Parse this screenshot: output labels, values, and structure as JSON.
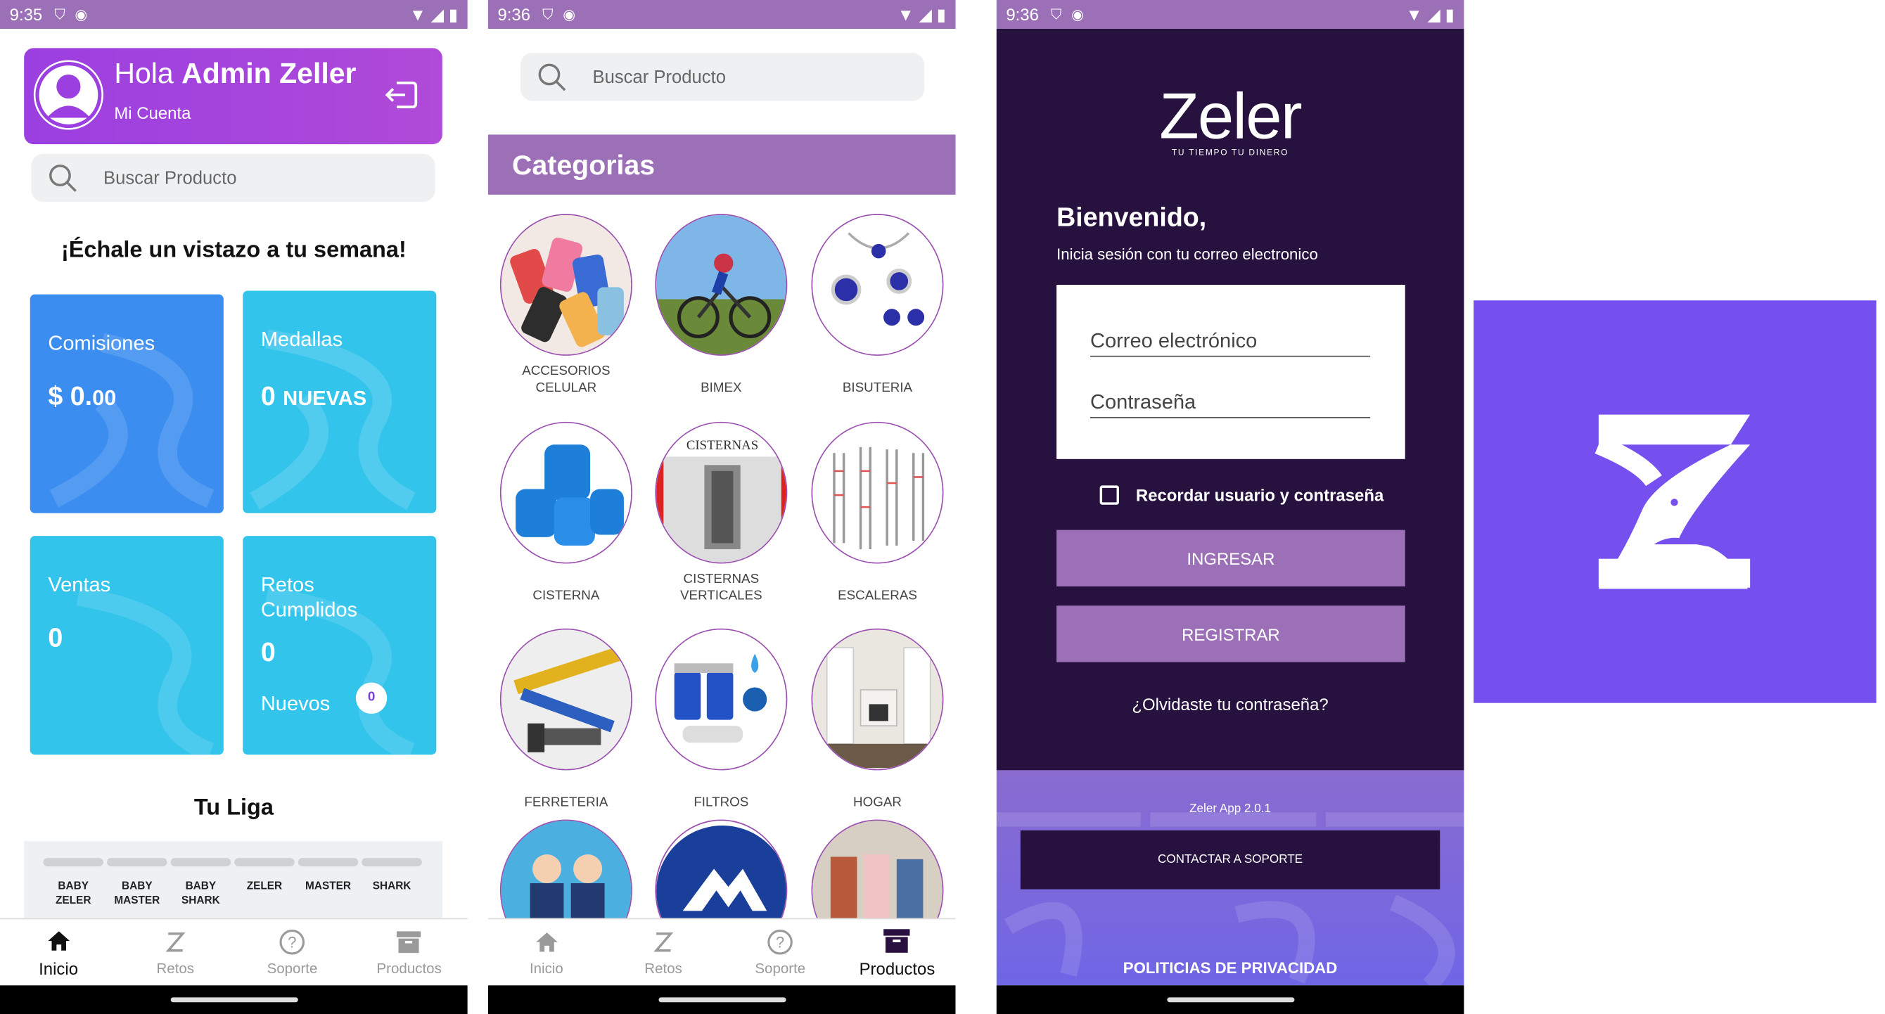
{
  "status": {
    "time1": "9:35",
    "time2": "9:36",
    "time3": "9:36"
  },
  "home": {
    "greeting_prefix": "Hola",
    "greeting_name": "Admin Zeller",
    "my_account": "Mi Cuenta",
    "search_placeholder": "Buscar Producto",
    "week_title": "¡Échale un vistazo a tu semana!",
    "cards": {
      "comisiones": {
        "label": "Comisiones",
        "value_main": "$ 0.",
        "value_cents": "00",
        "color": "#3b8ef0"
      },
      "medallas": {
        "label": "Medallas",
        "value_num": "0",
        "value_text": "NUEVAS",
        "color": "#33c4ec"
      },
      "ventas": {
        "label": "Ventas",
        "value": "0",
        "color": "#33c4ec"
      },
      "retos": {
        "label_line1": "Retos",
        "label_line2": "Cumplidos",
        "value": "0",
        "new_label": "Nuevos",
        "new_count": "0",
        "color": "#33c4ec"
      }
    },
    "league_title": "Tu Liga",
    "leagues": [
      {
        "line1": "BABY",
        "line2": "ZELER"
      },
      {
        "line1": "BABY",
        "line2": "MASTER"
      },
      {
        "line1": "BABY",
        "line2": "SHARK"
      },
      {
        "line1": "ZELER",
        "line2": ""
      },
      {
        "line1": "MASTER",
        "line2": ""
      },
      {
        "line1": "SHARK",
        "line2": ""
      }
    ]
  },
  "nav": {
    "inicio": "Inicio",
    "retos": "Retos",
    "soporte": "Soporte",
    "productos": "Productos"
  },
  "products": {
    "search_placeholder": "Buscar Producto",
    "header": "Categorias",
    "categories": [
      {
        "line1": "ACCESORIOS",
        "line2": "CELULAR"
      },
      {
        "line1": "BIMEX",
        "line2": ""
      },
      {
        "line1": "BISUTERIA",
        "line2": ""
      },
      {
        "line1": "CISTERNA",
        "line2": ""
      },
      {
        "line1": "CISTERNAS",
        "line2": "VERTICALES"
      },
      {
        "line1": "ESCALERAS",
        "line2": ""
      },
      {
        "line1": "FERRETERIA",
        "line2": ""
      },
      {
        "line1": "FILTROS",
        "line2": ""
      },
      {
        "line1": "HOGAR",
        "line2": ""
      }
    ],
    "cisternas_image_text": "CISTERNAS"
  },
  "login": {
    "logo": "Zeler",
    "tagline": "TU TIEMPO TU DINERO",
    "welcome": "Bienvenido,",
    "subtitle": "Inicia sesión con tu correo electronico",
    "email_placeholder": "Correo electrónico",
    "password_placeholder": "Contraseña",
    "remember": "Recordar usuario y contraseña",
    "login_button": "INGRESAR",
    "register_button": "REGISTRAR",
    "forgot": "¿Olvidaste tu contraseña?",
    "version": "Zeler App 2.0.1",
    "support_button": "CONTACTAR A SOPORTE",
    "privacy": "POLITICIAS DE PRIVACIDAD"
  },
  "colors": {
    "purple": "#9b70b6",
    "dark": "#26113f",
    "brand_blue": "#7650ee"
  }
}
